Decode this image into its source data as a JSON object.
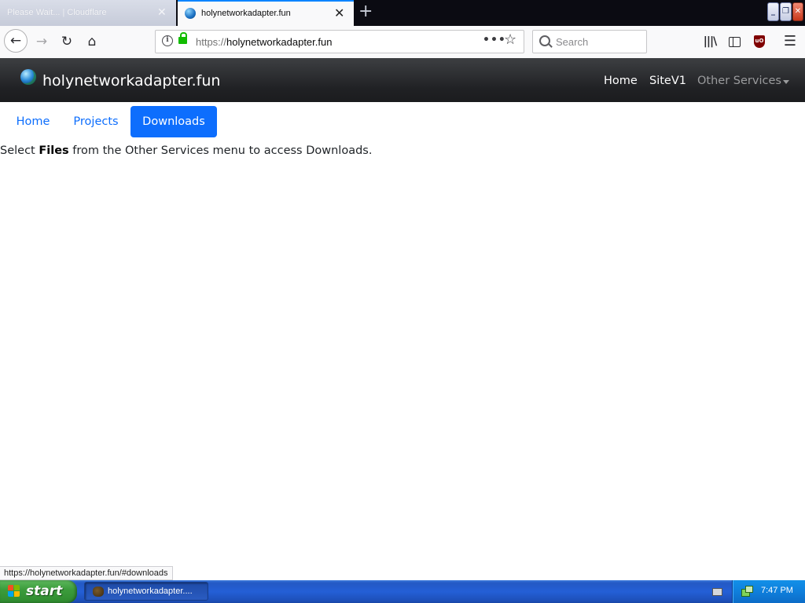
{
  "browser": {
    "tabs": [
      {
        "title": "Please Wait... | Cloudflare",
        "active": false
      },
      {
        "title": "holynetworkadapter.fun",
        "active": true
      }
    ],
    "new_tab_glyph": "+",
    "url_scheme": "https://",
    "url_host": "holynetworkadapter.fun",
    "page_actions_glyph": "•••",
    "search_placeholder": "Search",
    "accent_color": "#0a84ff",
    "icons": [
      "back-icon",
      "forward-icon",
      "reload-icon",
      "home-icon",
      "info-icon",
      "lock-icon",
      "star-icon",
      "search-icon",
      "library-icon",
      "sidebar-icon",
      "ublock-icon",
      "menu-icon"
    ]
  },
  "site": {
    "brand": "holynetworkadapter.fun",
    "nav": {
      "home": "Home",
      "sitev1": "SiteV1",
      "other_services": "Other Services"
    },
    "pills": {
      "home": "Home",
      "projects": "Projects",
      "downloads": "Downloads",
      "active": "Downloads"
    },
    "message": {
      "before": "Select ",
      "bold": "Files",
      "after": " from the Other Services menu to access Downloads."
    },
    "primary_color": "#0d6efd"
  },
  "status_bar": {
    "hover_url": "https://holynetworkadapter.fun/#downloads"
  },
  "taskbar": {
    "start_label": "start",
    "task_label": "holynetworkadapter....",
    "clock": "7:47 PM"
  }
}
